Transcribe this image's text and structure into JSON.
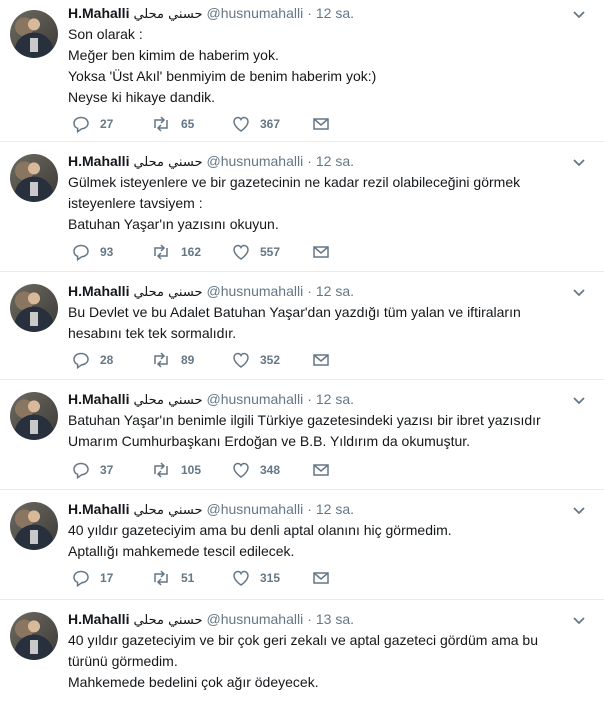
{
  "tweets": [
    {
      "author": "H.Mahalli",
      "author_arabic": "حسني محلي",
      "handle": "@husnumahalli",
      "time": "12 sa.",
      "text": "Son olarak :\nMeğer ben kimim de haberim yok.\nYoksa 'Üst Akıl' benmiyim de benim haberim yok:)\nNeyse ki hikaye dandik.",
      "replies": "27",
      "retweets": "65",
      "likes": "367"
    },
    {
      "author": "H.Mahalli",
      "author_arabic": "حسني محلي",
      "handle": "@husnumahalli",
      "time": "12 sa.",
      "text": "Gülmek isteyenlere ve bir gazetecinin ne kadar rezil olabileceğini görmek\nisteyenlere tavsiyem :\nBatuhan Yaşar'ın yazısını okuyun.",
      "replies": "93",
      "retweets": "162",
      "likes": "557"
    },
    {
      "author": "H.Mahalli",
      "author_arabic": "حسني محلي",
      "handle": "@husnumahalli",
      "time": "12 sa.",
      "text": "Bu Devlet  ve bu Adalet Batuhan Yaşar'dan yazdığı tüm yalan ve iftiraların\nhesabını tek tek sormalıdır.",
      "replies": "28",
      "retweets": "89",
      "likes": "352"
    },
    {
      "author": "H.Mahalli",
      "author_arabic": "حسني محلي",
      "handle": "@husnumahalli",
      "time": "12 sa.",
      "text": "Batuhan Yaşar'ın benimle ilgili Türkiye gazetesindeki yazısı bir ibret yazısıdır\nUmarım Cumhurbaşkanı Erdoğan ve B.B. Yıldırım da okumuştur.",
      "replies": "37",
      "retweets": "105",
      "likes": "348"
    },
    {
      "author": "H.Mahalli",
      "author_arabic": "حسني محلي",
      "handle": "@husnumahalli",
      "time": "12 sa.",
      "text": "40 yıldır gazeteciyim ama bu denli aptal olanını hiç görmedim.\nAptallığı mahkemede tescil edilecek.",
      "replies": "17",
      "retweets": "51",
      "likes": "315"
    },
    {
      "author": "H.Mahalli",
      "author_arabic": "حسني محلي",
      "handle": "@husnumahalli",
      "time": "13 sa.",
      "text": "40 yıldır gazeteciyim ve bir çok geri zekalı ve aptal gazeteci gördüm ama bu\ntürünü görmedim.\nMahkemede bedelini çok ağır ödeyecek.",
      "replies": "",
      "retweets": "",
      "likes": ""
    }
  ],
  "icons": {
    "reply": "reply-icon",
    "retweet": "retweet-icon",
    "like": "heart-icon",
    "dm": "envelope-icon",
    "menu": "chevron-down-icon"
  },
  "colors": {
    "icon": "#657786",
    "divider": "#e6ecf0",
    "text": "#14171a"
  }
}
